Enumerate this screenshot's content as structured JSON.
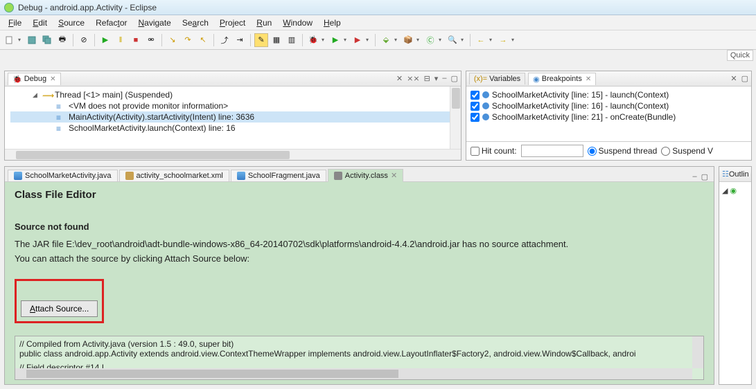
{
  "title": "Debug - android.app.Activity - Eclipse",
  "menu": [
    "File",
    "Edit",
    "Source",
    "Refactor",
    "Navigate",
    "Search",
    "Project",
    "Run",
    "Window",
    "Help"
  ],
  "quick": "Quick",
  "debug": {
    "tab_label": "Debug",
    "thread": "Thread [<1> main] (Suspended)",
    "frames": [
      "<VM does not provide monitor information>",
      "MainActivity(Activity).startActivity(Intent) line: 3636",
      "SchoolMarketActivity.launch(Context) line: 16"
    ]
  },
  "right_tabs": {
    "variables": "Variables",
    "breakpoints": "Breakpoints"
  },
  "breakpoints": [
    "SchoolMarketActivity [line: 15] - launch(Context)",
    "SchoolMarketActivity [line: 16] - launch(Context)",
    "SchoolMarketActivity [line: 21] - onCreate(Bundle)"
  ],
  "hit": {
    "label": "Hit count:",
    "suspend_thread": "Suspend thread",
    "suspend_vm": "Suspend V"
  },
  "editor_tabs": [
    {
      "label": "SchoolMarketActivity.java",
      "type": "java"
    },
    {
      "label": "activity_schoolmarket.xml",
      "type": "xml"
    },
    {
      "label": "SchoolFragment.java",
      "type": "java"
    },
    {
      "label": "Activity.class",
      "type": "class",
      "active": true
    }
  ],
  "editor": {
    "heading": "Class File Editor",
    "sub": "Source not found",
    "line1": "The JAR file E:\\dev_root\\android\\adt-bundle-windows-x86_64-20140702\\sdk\\platforms\\android-4.4.2\\android.jar has no source attachment.",
    "line2": "You can attach the source by clicking Attach Source below:",
    "attach_btn": "Attach Source...",
    "code1": "// Compiled from Activity.java (version 1.5 : 49.0, super bit)",
    "code2": "public class android.app.Activity extends android.view.ContextThemeWrapper implements android.view.LayoutInflater$Factory2, android.view.Window$Callback, androi",
    "code3": "  // Field descriptor #14 I"
  },
  "outline": {
    "label": "Outlin"
  }
}
